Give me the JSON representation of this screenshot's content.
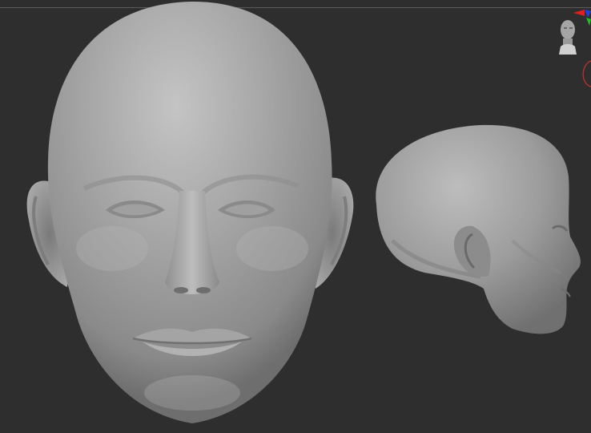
{
  "app": {
    "viewport": {
      "background": "#2e2e2e",
      "material_color": "#9a9a9a",
      "objects": [
        {
          "name": "head-front-view",
          "icon": "sculpt-head-front"
        },
        {
          "name": "head-side-view",
          "icon": "sculpt-head-profile"
        }
      ]
    },
    "navigation": {
      "thumbnail_icon": "head-bust-icon",
      "axis_gizmo_colors": {
        "x": "#e02020",
        "y": "#20c020",
        "z": "#2040e0"
      },
      "orbit_ring_color": "#b03030"
    }
  }
}
